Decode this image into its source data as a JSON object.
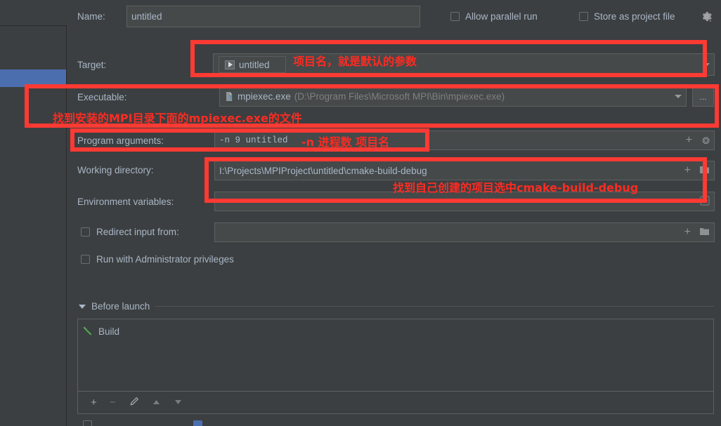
{
  "window": {
    "theme_bg": "#3c3f41",
    "accent": "#4b6eaf",
    "annotation_color": "#fd3a33"
  },
  "form": {
    "name": {
      "label": "Name:",
      "value": "untitled"
    },
    "allow_parallel_run": {
      "label": "Allow parallel run",
      "checked": false
    },
    "store_as_project_file": {
      "label": "Store as project file",
      "checked": false
    },
    "target": {
      "label": "Target:",
      "value": "untitled",
      "icon": "run-configuration-icon"
    },
    "executable": {
      "label": "Executable:",
      "value": "mpiexec.exe",
      "path_hint": "(D:\\Program Files\\Microsoft MPI\\Bin\\mpiexec.exe)",
      "browse_label": "..."
    },
    "program_arguments": {
      "label": "Program arguments:",
      "value": "-n 9 untitled"
    },
    "working_directory": {
      "label": "Working directory:",
      "value": "I:\\Projects\\MPIProject\\untitled\\cmake-build-debug"
    },
    "environment_variables": {
      "label": "Environment variables:",
      "value": ""
    },
    "redirect_input_from": {
      "label": "Redirect input from:",
      "checked": false,
      "value": ""
    },
    "run_with_admin": {
      "label": "Run with Administrator privileges",
      "checked": false
    }
  },
  "before_launch": {
    "title": "Before launch",
    "items": [
      {
        "label": "Build",
        "icon": "hammer-icon"
      }
    ],
    "toolbar": {
      "add": "+",
      "remove": "−",
      "edit": "✎",
      "move_up": "▲",
      "move_down": "▼"
    }
  },
  "annotations": [
    {
      "id": "target-note",
      "text": "项目名，就是默认的参数"
    },
    {
      "id": "exec-note",
      "text": "找到安装的MPI目录下面的mpiexec.exe的文件"
    },
    {
      "id": "args-note",
      "text": "-n 进程数 项目名"
    },
    {
      "id": "workdir-note",
      "text": "找到自己创建的项目选中cmake-build-debug"
    }
  ]
}
